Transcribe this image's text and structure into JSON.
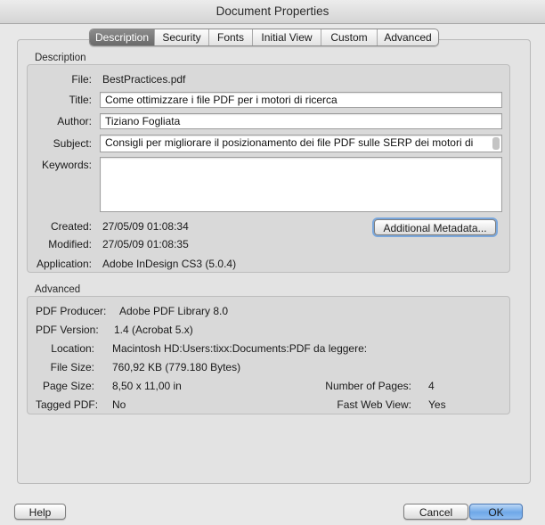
{
  "window": {
    "title": "Document Properties"
  },
  "tabs": [
    "Description",
    "Security",
    "Fonts",
    "Initial View",
    "Custom",
    "Advanced"
  ],
  "active_tab": "Description",
  "description": {
    "section_label": "Description",
    "file_label": "File:",
    "file_value": "BestPractices.pdf",
    "title_label": "Title:",
    "title_value": "Come ottimizzare i file PDF per i motori di ricerca",
    "author_label": "Author:",
    "author_value": "Tiziano Fogliata",
    "subject_label": "Subject:",
    "subject_value": "Consigli per migliorare il posizionamento dei file PDF sulle SERP dei motori di",
    "keywords_label": "Keywords:",
    "keywords_value": "",
    "created_label": "Created:",
    "created_value": "27/05/09 01:08:34",
    "modified_label": "Modified:",
    "modified_value": "27/05/09 01:08:35",
    "application_label": "Application:",
    "application_value": "Adobe InDesign CS3 (5.0.4)",
    "metadata_button": "Additional Metadata..."
  },
  "advanced": {
    "section_label": "Advanced",
    "producer_label": "PDF Producer:",
    "producer_value": "Adobe PDF Library 8.0",
    "version_label": "PDF Version:",
    "version_value": "1.4 (Acrobat 5.x)",
    "location_label": "Location:",
    "location_value": "Macintosh HD:Users:tixx:Documents:PDF da leggere:",
    "filesize_label": "File Size:",
    "filesize_value": "760,92 KB (779.180 Bytes)",
    "pagesize_label": "Page Size:",
    "pagesize_value": "8,50 x 11,00 in",
    "pages_label": "Number of Pages:",
    "pages_value": "4",
    "tagged_label": "Tagged PDF:",
    "tagged_value": "No",
    "fastweb_label": "Fast Web View:",
    "fastweb_value": "Yes"
  },
  "buttons": {
    "help": "Help",
    "cancel": "Cancel",
    "ok": "OK"
  }
}
